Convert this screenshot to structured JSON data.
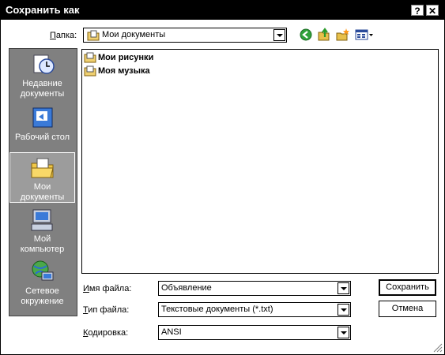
{
  "window": {
    "title": "Сохранить как",
    "help_label": "?",
    "close_label": "✕"
  },
  "folder": {
    "label_prefix": "П",
    "label_rest": "апка:",
    "value": "Мои документы"
  },
  "toolbar": {
    "back_icon": "back-arrow-icon",
    "up_icon": "folder-up-icon",
    "new_folder_icon": "new-folder-icon",
    "view_icon": "view-menu-icon"
  },
  "places": [
    {
      "label1": "Недавние",
      "label2": "документы",
      "icon": "recent-documents-icon"
    },
    {
      "label1": "Рабочий стол",
      "label2": "",
      "icon": "desktop-icon"
    },
    {
      "label1": "Мои",
      "label2": "документы",
      "icon": "my-documents-icon"
    },
    {
      "label1": "Мой",
      "label2": "компьютер",
      "icon": "my-computer-icon"
    },
    {
      "label1": "Сетевое",
      "label2": "окружение",
      "icon": "network-icon"
    }
  ],
  "files": [
    {
      "name": "Мои рисунки"
    },
    {
      "name": "Моя музыка"
    }
  ],
  "filename": {
    "label_prefix": "И",
    "label_rest": "мя файла:",
    "value": "Объявление"
  },
  "filetype": {
    "label_prefix": "Т",
    "label_rest": "ип файла:",
    "value": "Текстовые документы (*.txt)"
  },
  "encoding": {
    "label_prefix": "К",
    "label_rest": "одировка:",
    "value": "ANSI"
  },
  "buttons": {
    "save": "Сохранить",
    "cancel": "Отмена"
  }
}
